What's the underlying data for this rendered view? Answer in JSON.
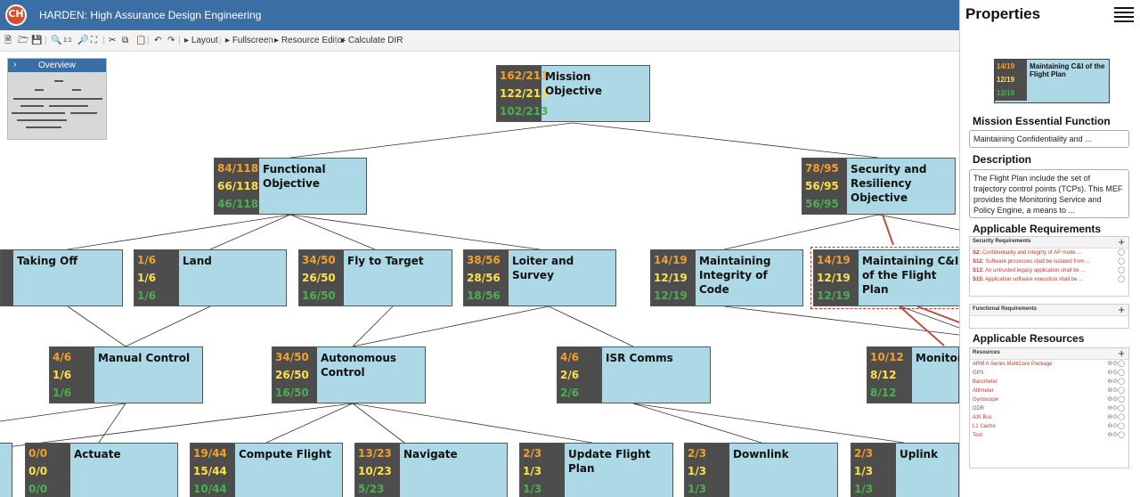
{
  "app": {
    "title": "HARDEN: High Assurance Design Engineering",
    "logo_icon": "harden-logo-icon"
  },
  "toolbar": {
    "layout": "Layout",
    "fullscreen": "Fullscreen",
    "resource_editor": "Resource Editor",
    "calculate_dir": "Calculate DIR",
    "zoom_1to1": "1:1"
  },
  "overview": {
    "label": "Overview"
  },
  "nodes": {
    "mission": {
      "c1": "162/213",
      "c2": "122/213",
      "c3": "102/213",
      "title": "Mission Objective"
    },
    "functional": {
      "c1": "84/118",
      "c2": "66/118",
      "c3": "46/118",
      "title": "Functional Objective"
    },
    "security": {
      "c1": "78/95",
      "c2": "56/95",
      "c3": "56/95",
      "title": "Security and Resiliency Objective"
    },
    "taking_off": {
      "title": "Taking Off"
    },
    "land": {
      "c1": "1/6",
      "c2": "1/6",
      "c3": "1/6",
      "title": "Land"
    },
    "fly": {
      "c1": "34/50",
      "c2": "26/50",
      "c3": "16/50",
      "title": "Fly to Target"
    },
    "loiter": {
      "c1": "38/56",
      "c2": "28/56",
      "c3": "18/56",
      "title": "Loiter and Survey"
    },
    "integrity": {
      "c1": "14/19",
      "c2": "12/19",
      "c3": "12/19",
      "title": "Maintaining Integrity of Code"
    },
    "cni": {
      "c1": "14/19",
      "c2": "12/19",
      "c3": "12/19",
      "title": "Maintaining C&I of the Flight Plan"
    },
    "manual": {
      "c1": "4/6",
      "c2": "1/6",
      "c3": "1/6",
      "title": "Manual Control"
    },
    "autonomous": {
      "c1": "34/50",
      "c2": "26/50",
      "c3": "16/50",
      "title": "Autonomous Control"
    },
    "isr": {
      "c1": "4/6",
      "c2": "2/6",
      "c3": "2/6",
      "title": "ISR Comms"
    },
    "monitoring": {
      "c1": "10/12",
      "c2": "8/12",
      "c3": "8/12",
      "title": "Monitori"
    },
    "actuate": {
      "c1": "0/0",
      "c2": "0/0",
      "c3": "0/0",
      "title": "Actuate"
    },
    "compute": {
      "c1": "19/44",
      "c2": "15/44",
      "c3": "10/44",
      "title": "Compute Flight"
    },
    "navigate": {
      "c1": "13/23",
      "c2": "10/23",
      "c3": "5/23",
      "title": "Navigate"
    },
    "update": {
      "c1": "2/3",
      "c2": "1/3",
      "c3": "1/3",
      "title": "Update Flight Plan"
    },
    "downlink": {
      "c1": "2/3",
      "c2": "1/3",
      "c3": "1/3",
      "title": "Downlink"
    },
    "uplink": {
      "c1": "2/3",
      "c2": "1/3",
      "c3": "1/3",
      "title": "Uplink"
    }
  },
  "props": {
    "title": "Properties",
    "selected": {
      "c1": "14/19",
      "c2": "12/19",
      "c3": "12/19",
      "title": "Maintaining C&I of the Flight Plan"
    },
    "mef_label": "Mission Essential Function",
    "mef_value": "Maintaining Confidentiality and ...",
    "desc_label": "Description",
    "desc_value": "The Flight Plan include the set of trajectory control points (TCPs). This MEF provides the Monitoring Service and Policy Engine, a means to ...",
    "req_label": "Applicable Requirements",
    "sec_req_head": "Security Requirements",
    "sec_reqs": [
      {
        "id": "S2:",
        "text": "Confidentiality and integrity of AP mode ..."
      },
      {
        "id": "S12:",
        "text": "Software processes shall be isolated from ..."
      },
      {
        "id": "S13:",
        "text": "An untrusted legacy application shall be ..."
      },
      {
        "id": "S15:",
        "text": "Application software execution shall be ..."
      }
    ],
    "func_req_head": "Functional Requirements",
    "res_label": "Applicable Resources",
    "res_head": "Resources",
    "resources": [
      "ARM A Series MultiCore Package",
      "GPS",
      "Barometer",
      "Altimeter",
      "Gyroscope",
      "DDR",
      "AXI Bus",
      "L1 Cache",
      "Text"
    ],
    "add_symbol": "+"
  },
  "colors": {
    "header": "#3a6ea5",
    "node_fill": "#add8e6",
    "count_box": "#4d4d4d",
    "orange": "#f0a030",
    "yellow": "#ffe04a",
    "green": "#4caf50",
    "selection": "#c0392b"
  }
}
